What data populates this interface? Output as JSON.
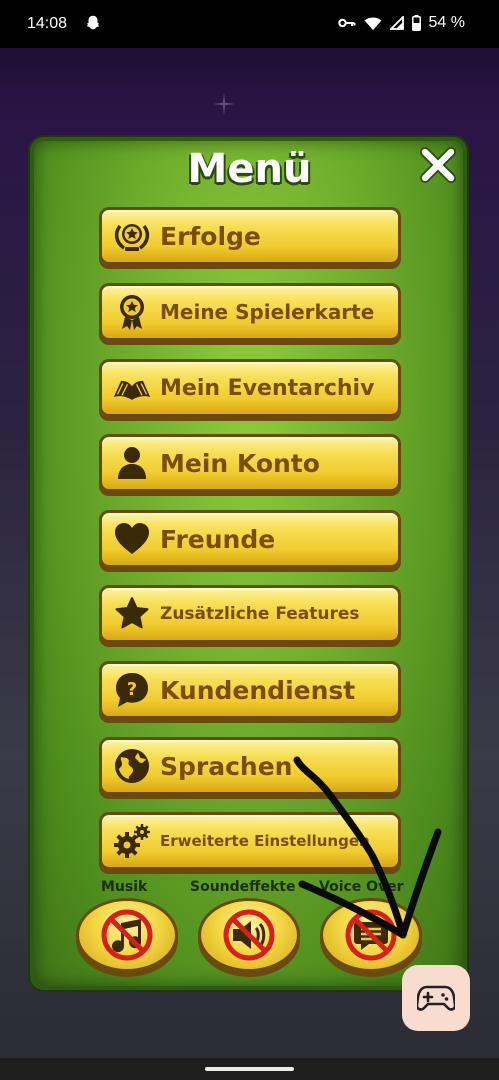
{
  "status_bar": {
    "time": "14:08",
    "battery": "54 %",
    "icons": [
      "snapchat-ghost-icon",
      "vpn-key-icon",
      "wifi-icon",
      "signal-icon",
      "battery-icon"
    ]
  },
  "menu": {
    "title": "Menü",
    "items": [
      {
        "label": "Erfolge",
        "icon": "laurel-star-icon"
      },
      {
        "label": "Meine Spielerkarte",
        "icon": "medal-icon"
      },
      {
        "label": "Mein Eventarchiv",
        "icon": "open-book-icon"
      },
      {
        "label": "Mein Konto",
        "icon": "user-icon"
      },
      {
        "label": "Freunde",
        "icon": "heart-icon"
      },
      {
        "label": "Zusätzliche Features",
        "icon": "star-icon"
      },
      {
        "label": "Kundendienst",
        "icon": "help-bubble-icon"
      },
      {
        "label": "Sprachen",
        "icon": "globe-icon"
      },
      {
        "label": "Erweiterte Einstellungen",
        "icon": "gears-icon"
      }
    ]
  },
  "sound": {
    "music_label": "Musik",
    "effects_label": "Soundeffekte",
    "voice_label": "Voice Over",
    "music_state": "muted",
    "effects_state": "muted",
    "voice_state": "muted"
  },
  "colors": {
    "button_text": "#7b4d0b",
    "button_face": "#f0cc2e",
    "panel_green": "#6fae2c"
  }
}
